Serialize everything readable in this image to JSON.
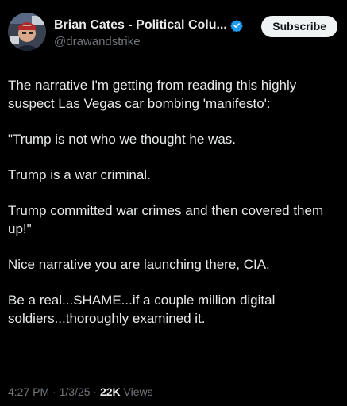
{
  "author": {
    "display_name": "Brian Cates - Political Colu...",
    "handle": "@drawandstrike",
    "verified_icon": "verified-badge-icon"
  },
  "actions": {
    "subscribe_label": "Subscribe"
  },
  "post": {
    "paragraphs": [
      "The narrative I'm getting from reading this highly suspect Las Vegas car bombing 'manifesto':",
      "\"Trump is not who we thought he was.",
      "Trump is a war criminal.",
      "Trump committed war crimes and then covered them up!\"",
      "Nice narrative you are launching there, CIA.",
      "Be a real...SHAME...if a couple million digital soldiers...thoroughly examined it."
    ]
  },
  "meta": {
    "time": "4:27 PM",
    "separator": " · ",
    "date": "1/3/25",
    "views_count": "22K",
    "views_label": " Views"
  },
  "colors": {
    "background": "#000000",
    "text": "#e7e9ea",
    "muted": "#71767b",
    "verified": "#1d9bf0",
    "button_bg": "#eff3f4"
  }
}
